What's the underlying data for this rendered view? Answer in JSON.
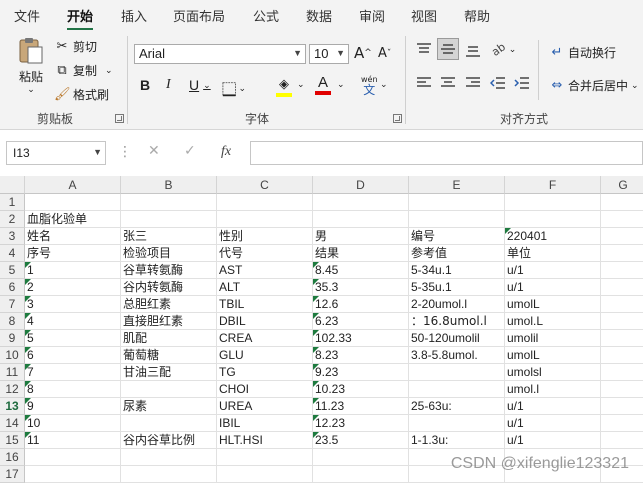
{
  "menu": [
    "文件",
    "开始",
    "插入",
    "页面布局",
    "公式",
    "数据",
    "审阅",
    "视图",
    "帮助"
  ],
  "active_menu_index": 1,
  "clipboard": {
    "paste": "粘贴",
    "cut": "剪切",
    "copy": "复制",
    "format_painter": "格式刷",
    "group_label": "剪贴板"
  },
  "font": {
    "name": "Arial",
    "size": "10",
    "grow_label": "A",
    "shrink_label": "A",
    "bold": "B",
    "italic": "I",
    "underline": "U",
    "font_color_label": "A",
    "phonetic_top": "wén",
    "phonetic_bottom": "文",
    "group_label": "字体"
  },
  "alignment": {
    "wrap_text": "自动换行",
    "merge_center": "合并后居中",
    "group_label": "对齐方式"
  },
  "formula_bar": {
    "name_box": "I13",
    "cancel": "✕",
    "enter": "✓",
    "fx": "fx",
    "value": ""
  },
  "columns": [
    "A",
    "B",
    "C",
    "D",
    "E",
    "F",
    "G"
  ],
  "rows": [
    {
      "n": "1",
      "cells": [
        "",
        "",
        "",
        "",
        "",
        ""
      ]
    },
    {
      "n": "2",
      "cells": [
        "血脂化验单",
        "",
        "",
        "",
        "",
        ""
      ]
    },
    {
      "n": "3",
      "cells": [
        "姓名",
        "张三",
        "性别",
        "男",
        "编号",
        "220401"
      ]
    },
    {
      "n": "4",
      "cells": [
        "序号",
        "检验项目",
        "代号",
        "结果",
        "参考值",
        "单位"
      ]
    },
    {
      "n": "5",
      "cells": [
        "1",
        "谷草转氨酶",
        "AST",
        "8.45",
        "5-34u.1",
        "u/1"
      ]
    },
    {
      "n": "6",
      "cells": [
        "2",
        "谷内转氨酶",
        "ALT",
        "35.3",
        "5-35u.1",
        "u/1"
      ]
    },
    {
      "n": "7",
      "cells": [
        "3",
        "总胆红素",
        "TBIL",
        "12.6",
        "2-20umol.l",
        "umolL"
      ]
    },
    {
      "n": "8",
      "cells": [
        "4",
        "直接胆红素",
        "DBIL",
        "6.23",
        "：16.8umol.l",
        "umol.L"
      ]
    },
    {
      "n": "9",
      "cells": [
        "5",
        "肌配",
        "CREA",
        "102.33",
        "50-120umolil",
        "umolil"
      ]
    },
    {
      "n": "10",
      "cells": [
        "6",
        "葡萄糖",
        "GLU",
        "8.23",
        "3.8-5.8umol.",
        "umolL"
      ]
    },
    {
      "n": "11",
      "cells": [
        "7",
        "甘油三配",
        "TG",
        "9.23",
        "",
        "umolsl"
      ]
    },
    {
      "n": "12",
      "cells": [
        "8",
        "",
        "CHOI",
        "10.23",
        "",
        "umol.l"
      ]
    },
    {
      "n": "13",
      "cells": [
        "9",
        "尿素",
        "UREA",
        "11.23",
        "25-63u:",
        "u/1"
      ]
    },
    {
      "n": "14",
      "cells": [
        "10",
        "",
        "IBIL",
        "12.23",
        "",
        "u/1"
      ]
    },
    {
      "n": "15",
      "cells": [
        "11",
        "谷内谷草比例",
        "HLT.HSI",
        "23.5",
        "1-1.3u:",
        "u/1"
      ]
    },
    {
      "n": "16",
      "cells": [
        "",
        "",
        "",
        "",
        "",
        ""
      ]
    },
    {
      "n": "17",
      "cells": [
        "",
        "",
        "",
        "",
        "",
        ""
      ]
    }
  ],
  "selected_row": "13",
  "accent_color": "#217346",
  "watermark": "CSDN @xifenglie123321"
}
